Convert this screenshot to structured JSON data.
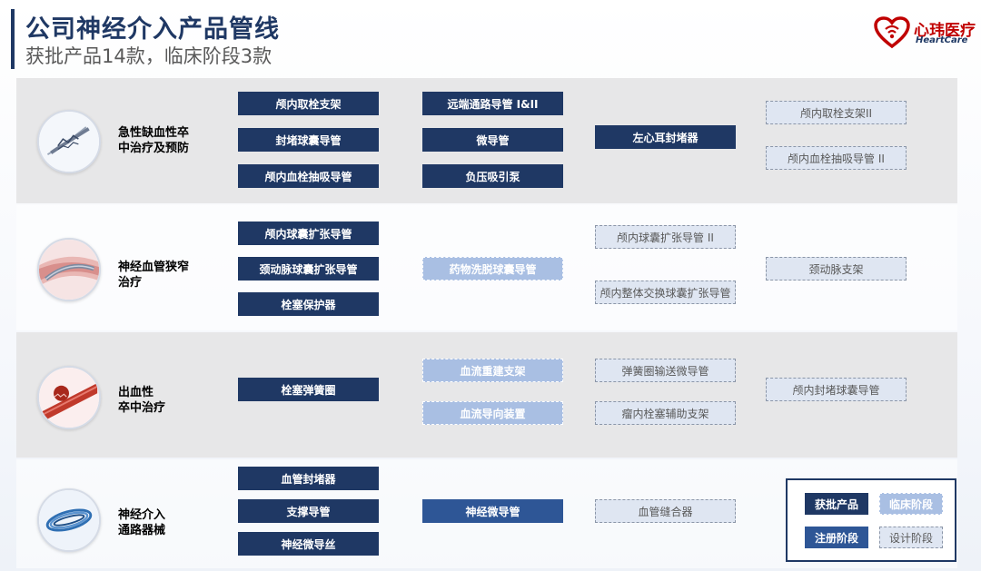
{
  "header": {
    "title": "公司神经介入产品管线",
    "subtitle": "获批产品14款，临床阶段3款"
  },
  "logo": {
    "name_cn": "心玮医疗",
    "name_en": "HeartCare",
    "colors": {
      "heart": "#c00000",
      "text": "#1f3864"
    }
  },
  "colors": {
    "approved": "#1f3864",
    "registration": "#2e5696",
    "clinical": "#a9bfe3",
    "design": "#dfe6f2"
  },
  "categories": [
    {
      "label": "急性缺血性卒中治疗及预防",
      "label_lines": [
        "急性缺血性卒",
        "中治疗及预防"
      ],
      "icon": "stent-retriever-icon",
      "products": [
        {
          "name": "颅内取栓支架",
          "status": "approved"
        },
        {
          "name": "封堵球囊导管",
          "status": "approved"
        },
        {
          "name": "颅内血栓抽吸导管",
          "status": "approved"
        },
        {
          "name": "远端通路导管 I&II",
          "status": "approved"
        },
        {
          "name": "微导管",
          "status": "approved"
        },
        {
          "name": "负压吸引泵",
          "status": "approved"
        },
        {
          "name": "左心耳封堵器",
          "status": "approved"
        },
        {
          "name": "颅内取栓支架II",
          "status": "design"
        },
        {
          "name": "颅内血栓抽吸导管 II",
          "status": "design"
        }
      ]
    },
    {
      "label": "神经血管狭窄治疗",
      "label_lines": [
        "神经血管狭窄",
        "治疗"
      ],
      "icon": "vessel-stenosis-icon",
      "products": [
        {
          "name": "颅内球囊扩张导管",
          "status": "approved"
        },
        {
          "name": "颈动脉球囊扩张导管",
          "status": "approved"
        },
        {
          "name": "栓塞保护器",
          "status": "approved"
        },
        {
          "name": "药物洗脱球囊导管",
          "status": "clinical"
        },
        {
          "name": "颅内球囊扩张导管 II",
          "status": "design"
        },
        {
          "name": "颅内整体交换球囊扩张导管",
          "status": "design"
        },
        {
          "name": "颈动脉支架",
          "status": "design"
        }
      ]
    },
    {
      "label": "出血性卒中治疗",
      "label_lines": [
        "出血性",
        "卒中治疗"
      ],
      "icon": "aneurysm-icon",
      "products": [
        {
          "name": "栓塞弹簧圈",
          "status": "approved"
        },
        {
          "name": "血流重建支架",
          "status": "clinical"
        },
        {
          "name": "血流导向装置",
          "status": "clinical"
        },
        {
          "name": "弹簧圈输送微导管",
          "status": "design"
        },
        {
          "name": "瘤内栓塞辅助支架",
          "status": "design"
        },
        {
          "name": "颅内封堵球囊导管",
          "status": "design"
        }
      ]
    },
    {
      "label": "神经介入通路器械",
      "label_lines": [
        "神经介入",
        "通路器械"
      ],
      "icon": "guidewire-coil-icon",
      "products": [
        {
          "name": "血管封堵器",
          "status": "approved"
        },
        {
          "name": "支撑导管",
          "status": "approved"
        },
        {
          "name": "神经微导丝",
          "status": "approved"
        },
        {
          "name": "神经微导管",
          "status": "registration"
        },
        {
          "name": "血管缝合器",
          "status": "design"
        }
      ]
    }
  ],
  "legend": [
    {
      "label": "获批产品",
      "status": "approved"
    },
    {
      "label": "临床阶段",
      "status": "clinical"
    },
    {
      "label": "注册阶段",
      "status": "registration"
    },
    {
      "label": "设计阶段",
      "status": "design"
    }
  ]
}
